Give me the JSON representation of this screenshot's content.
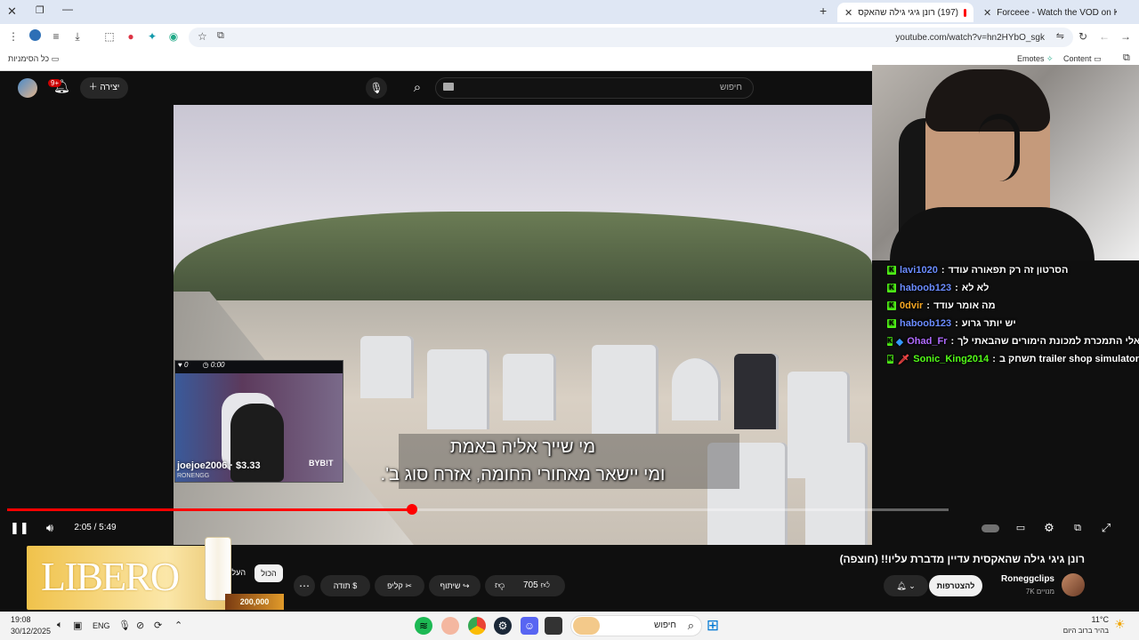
{
  "browser": {
    "tabs": [
      {
        "title": "Forceee - Watch the VOD on K",
        "favicon_color": "#53fc18"
      },
      {
        "title": "(197) רונן גיגי גילה שהאקס",
        "favicon_color": "#ff0000"
      }
    ],
    "url": "youtube.com/watch?v=hn2HYbO_sgk",
    "bookmarks": {
      "all_label": "כל הסימניות",
      "emotes": "Emotes",
      "content": "Content"
    }
  },
  "youtube": {
    "search_placeholder": "חיפוש",
    "create_label": "יצירה",
    "notif_badge": "9+",
    "video": {
      "subtitle_line1": "מי שייך אליה באמת",
      "subtitle_line2": "ומי יישאר מאחורי החומה, אזרח סוג ב'.",
      "time": "2:05 / 5:49",
      "progress": 0.3582,
      "title": "רונן גיגי גילה שהאקסית עדיין מדברת עליו!! (חוצפה)"
    },
    "channel": {
      "name": "Roneggclips",
      "subs": "7K מנויים",
      "subscribe": "להצטרפות"
    },
    "actions": {
      "likes": "705",
      "share": "שיתוף",
      "clip": "קליפ",
      "thanks": "תודה"
    },
    "chips": {
      "all": "הכול",
      "next": "העלו"
    },
    "ad": {
      "brand": "LIBERO",
      "price": "200,000"
    }
  },
  "stream": {
    "donation": "joejoe2006 · $3.33",
    "overlay_brand": "BYB!T",
    "overlay_handle": "RONENGG",
    "minicam_top_left": "0",
    "minicam_top_time": "0:00",
    "chat": [
      {
        "user": "lavi1020",
        "user_color": "#6b8cff",
        "msg": "הסרטון זה רק תפאורה עודד"
      },
      {
        "user": "haboob123",
        "user_color": "#6b8cff",
        "msg": "לא לא"
      },
      {
        "user": "0dvir",
        "user_color": "#f5a623",
        "msg": "מה אומר עודד"
      },
      {
        "user": "haboob123",
        "user_color": "#6b8cff",
        "msg": "יש יותר גרוע"
      },
      {
        "user": "Ohad_Fr",
        "user_color": "#b06bff",
        "msg": "ראלי התמכרת למכונת הימורים שהבאתי לך"
      },
      {
        "user": "Sonic_King2014",
        "user_color": "#53fc18",
        "msg": "תשחק ב trailer shop simulator"
      }
    ]
  },
  "taskbar": {
    "search": "חיפוש",
    "time": "19:08",
    "date": "30/12/2025",
    "lang": "ENG",
    "weather_temp": "11°C",
    "weather_desc": "בהיר ברוב היום"
  }
}
